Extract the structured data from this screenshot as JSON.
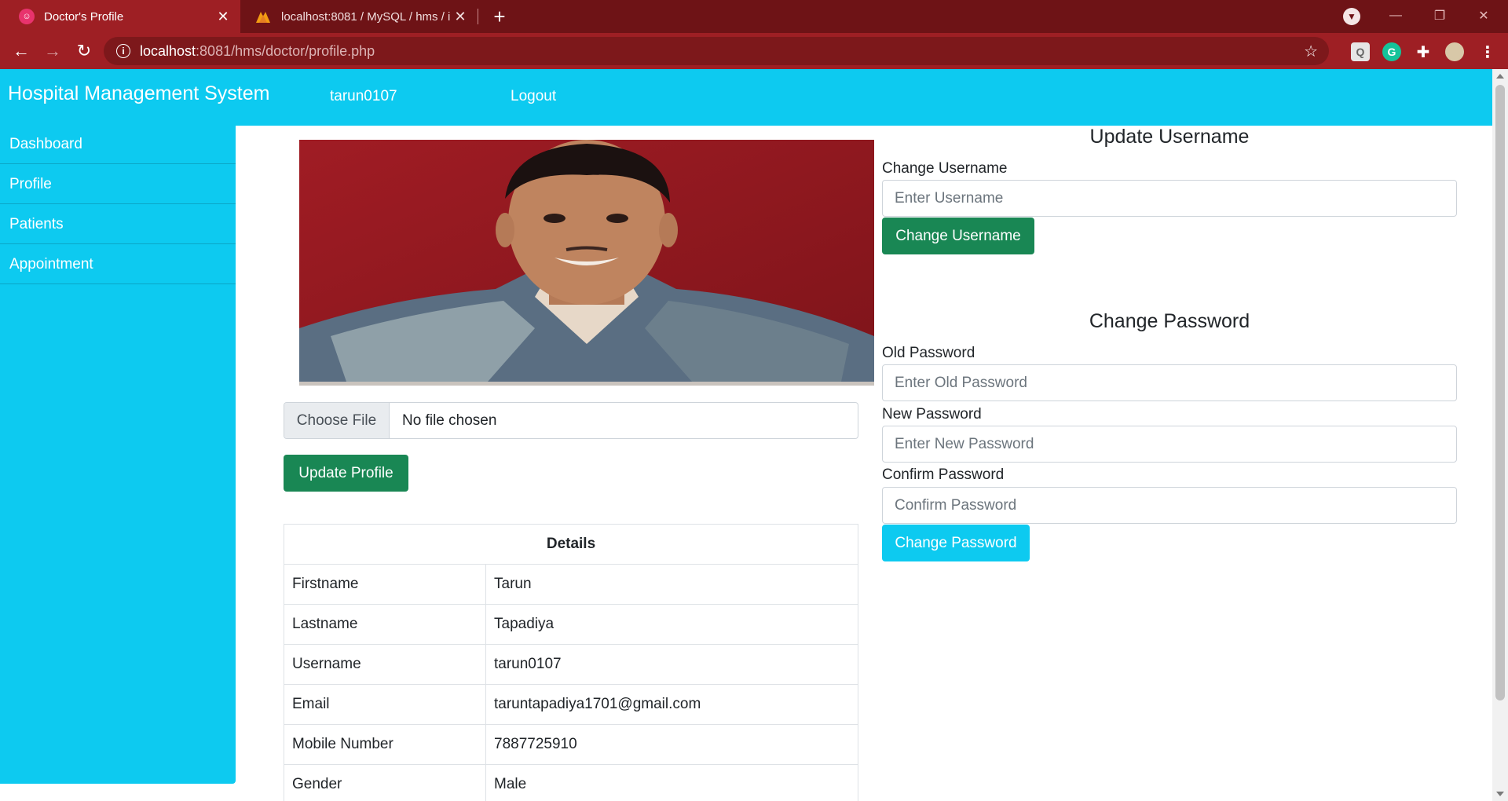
{
  "browser": {
    "tabs": [
      {
        "title": "Doctor's Profile",
        "active": true,
        "icon": "app-favicon"
      },
      {
        "title": "localhost:8081 / MySQL / hms / i",
        "active": false,
        "icon": "phpmyadmin-favicon"
      }
    ],
    "url": {
      "host": "localhost",
      "path": ":8081/hms/doctor/profile.php"
    }
  },
  "navbar": {
    "brand": "Hospital Management System",
    "username": "tarun0107",
    "logout": "Logout"
  },
  "sidebar": {
    "items": [
      {
        "label": "Dashboard"
      },
      {
        "label": "Profile"
      },
      {
        "label": "Patients"
      },
      {
        "label": "Appointment"
      }
    ]
  },
  "profile": {
    "file_button": "Choose File",
    "file_status": "No file chosen",
    "update_button": "Update Profile"
  },
  "details": {
    "header": "Details",
    "rows": [
      {
        "label": "Firstname",
        "value": "Tarun"
      },
      {
        "label": "Lastname",
        "value": "Tapadiya"
      },
      {
        "label": "Username",
        "value": "tarun0107"
      },
      {
        "label": "Email",
        "value": "taruntapadiya1701@gmail.com"
      },
      {
        "label": "Mobile Number",
        "value": "7887725910"
      },
      {
        "label": "Gender",
        "value": "Male"
      }
    ]
  },
  "update_username": {
    "title": "Update Username",
    "label": "Change Username",
    "placeholder": "Enter Username",
    "button": "Change Username"
  },
  "change_password": {
    "title": "Change Password",
    "old_label": "Old Password",
    "old_placeholder": "Enter Old Password",
    "new_label": "New Password",
    "new_placeholder": "Enter New Password",
    "confirm_label": "Confirm Password",
    "confirm_placeholder": "Confirm Password",
    "button": "Change Password"
  },
  "colors": {
    "chrome_dark": "#6e1316",
    "chrome": "#9e1f24",
    "primary": "#0dcaf0",
    "success": "#198754"
  }
}
